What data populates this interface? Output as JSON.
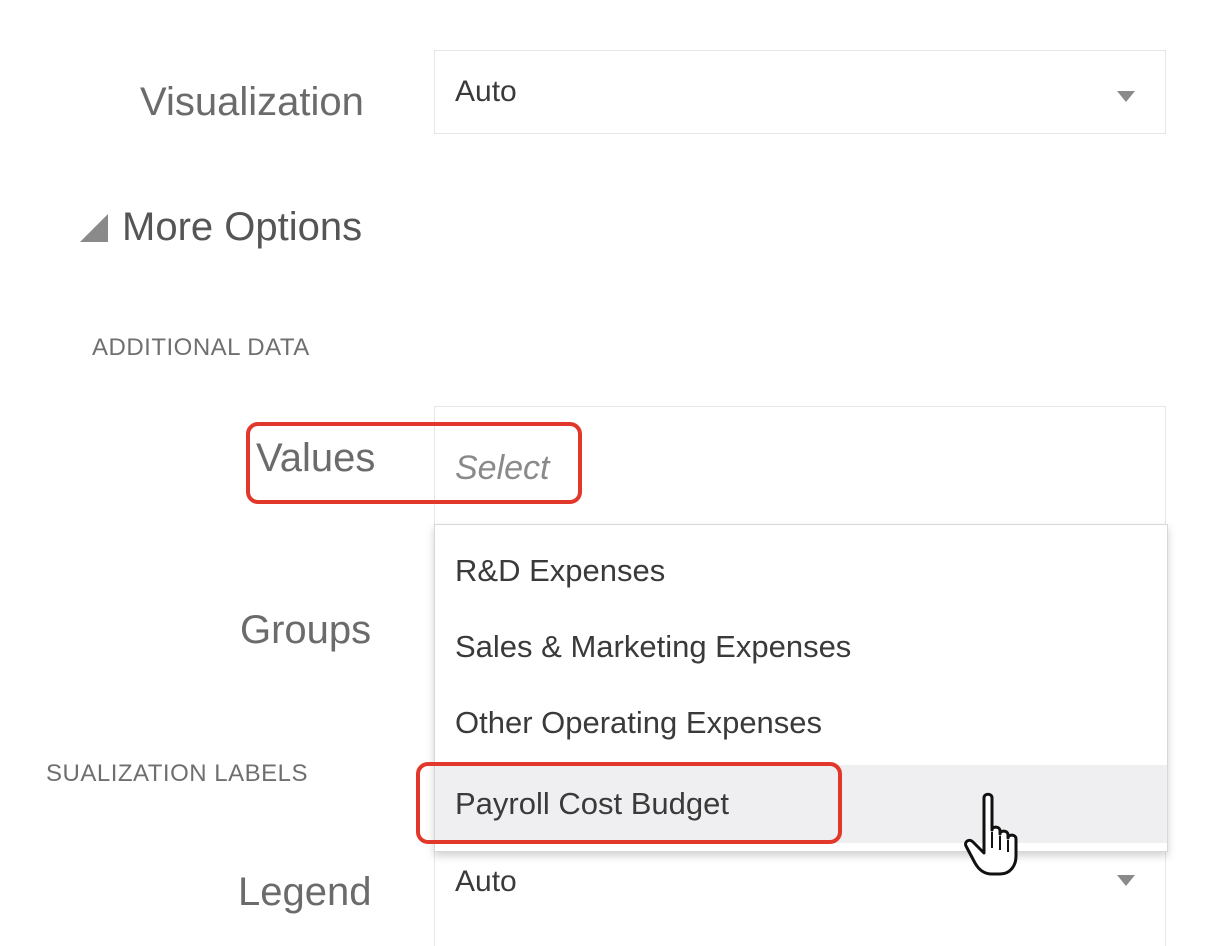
{
  "visualization": {
    "label": "Visualization",
    "value": "Auto"
  },
  "more_options": {
    "label": "More Options"
  },
  "additional_data": {
    "section_title": "ADDITIONAL DATA",
    "values": {
      "label": "Values",
      "placeholder": "Select"
    },
    "groups": {
      "label": "Groups"
    },
    "dropdown_options": [
      "R&D Expenses",
      "Sales & Marketing Expenses",
      "Other Operating Expenses",
      "Payroll Cost Budget"
    ],
    "hovered_option_index": 3
  },
  "visualization_labels": {
    "section_title": "SUALIZATION LABELS",
    "legend": {
      "label": "Legend",
      "value": "Auto"
    }
  },
  "colors": {
    "highlight": "#e2382b",
    "hover_bg": "#efeff1"
  },
  "icons": {
    "dropdown_arrow": "chevron-down-icon",
    "expand_triangle": "triangle-icon",
    "cursor": "hand-pointer-icon"
  }
}
